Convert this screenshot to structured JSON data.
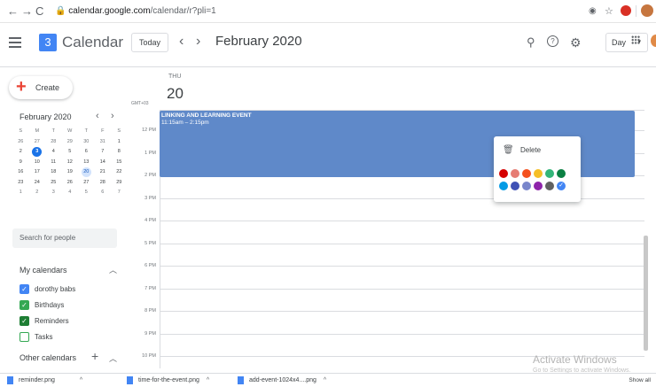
{
  "browser": {
    "url_host": "calendar.google.com",
    "url_path": "/calendar/r?pli=1",
    "back_icon": "←",
    "forward_icon": "→",
    "reload_icon": "C"
  },
  "header": {
    "logo_day": "3",
    "title": "Calendar",
    "today_label": "Today",
    "prev_icon": "‹",
    "next_icon": "›",
    "month_title": "February 2020",
    "view_label": "Day"
  },
  "sidebar": {
    "create_label": "Create",
    "mini_month": "February 2020",
    "mini_days_header": [
      "S",
      "M",
      "T",
      "W",
      "T",
      "F",
      "S"
    ],
    "mini_weeks": [
      [
        "26",
        "27",
        "28",
        "29",
        "30",
        "31",
        "1"
      ],
      [
        "2",
        "3",
        "4",
        "5",
        "6",
        "7",
        "8"
      ],
      [
        "9",
        "10",
        "11",
        "12",
        "13",
        "14",
        "15"
      ],
      [
        "16",
        "17",
        "18",
        "19",
        "20",
        "21",
        "22"
      ],
      [
        "23",
        "24",
        "25",
        "26",
        "27",
        "28",
        "29"
      ],
      [
        "1",
        "2",
        "3",
        "4",
        "5",
        "6",
        "7"
      ]
    ],
    "search_placeholder": "Search for people",
    "my_calendars_label": "My calendars",
    "my_calendars": [
      {
        "label": "dorothy babs",
        "color": "#4285f4",
        "checked": true
      },
      {
        "label": "Birthdays",
        "color": "#34a853",
        "checked": true
      },
      {
        "label": "Reminders",
        "color": "#1e7e34",
        "checked": true
      },
      {
        "label": "Tasks",
        "color": "#34a853",
        "checked": false
      }
    ],
    "other_calendars_label": "Other calendars"
  },
  "day": {
    "dow": "THU",
    "date": "20",
    "tz_label": "GMT+03",
    "hours": [
      "12 PM",
      "1 PM",
      "2 PM",
      "3 PM",
      "4 PM",
      "5 PM",
      "6 PM",
      "7 PM",
      "8 PM",
      "9 PM",
      "10 PM"
    ]
  },
  "event": {
    "title": "LINKING AND LEARNING EVENT",
    "time": "11:15am – 2:15pm",
    "color": "#5f89c9"
  },
  "popup": {
    "delete_label": "Delete",
    "colors_row1": [
      "#d50000",
      "#e67c73",
      "#f4511e",
      "#f6bf26",
      "#33b679",
      "#0b8043"
    ],
    "colors_row2": [
      "#039be5",
      "#3f51b5",
      "#7986cb",
      "#8e24aa",
      "#616161",
      "#4285f4"
    ]
  },
  "watermark": {
    "line1": "Activate Windows",
    "line2": "Go to Settings to activate Windows."
  },
  "downloads": {
    "items": [
      "reminder.png",
      "time-for-the-event.png",
      "add-event-1024x4....png"
    ],
    "show_all": "Show all"
  }
}
